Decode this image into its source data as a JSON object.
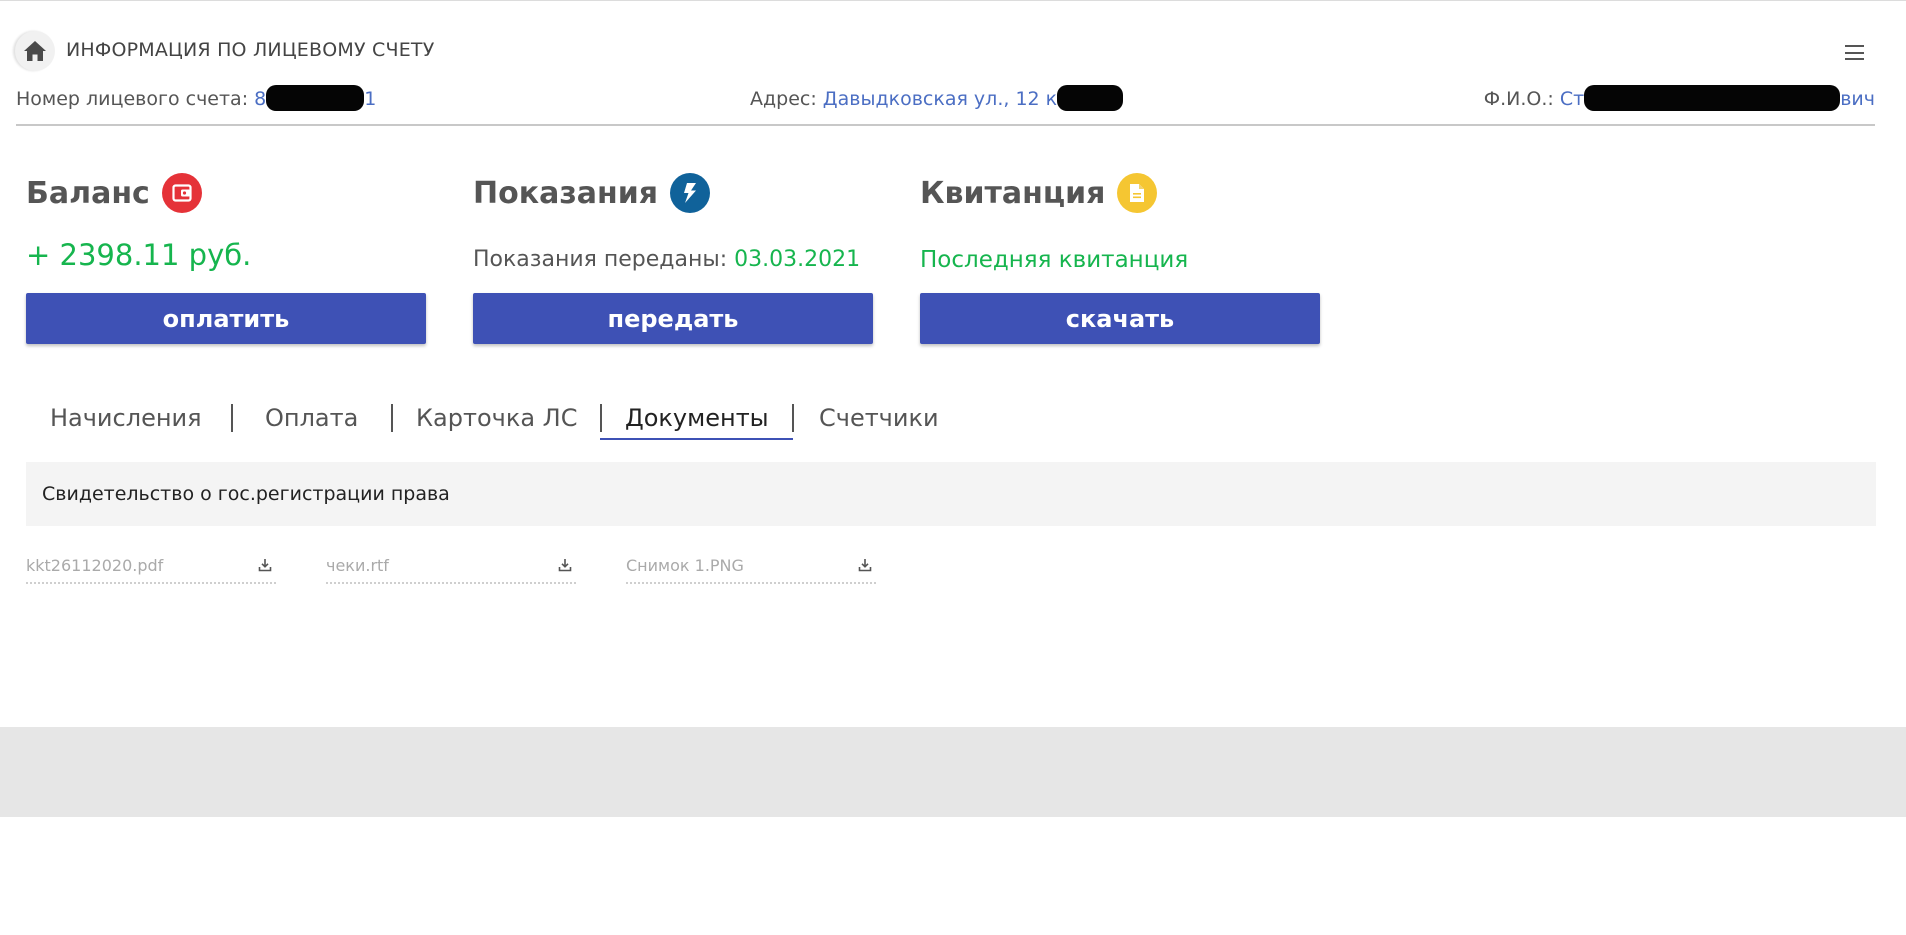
{
  "header": {
    "title": "ИНФОРМАЦИЯ ПО ЛИЦЕВОМУ СЧЕТУ",
    "account_label": "Номер лицевого счета:",
    "account_prefix": "8",
    "account_suffix": "1",
    "address_label": "Адрес:",
    "address_value": "Давыдковская ул., 12 к",
    "fio_label": "Ф.И.О.:",
    "fio_prefix": "Ст",
    "fio_suffix": "вич"
  },
  "cards": {
    "balance": {
      "title": "Баланс",
      "value": "+ 2398.11 руб.",
      "button": "оплатить"
    },
    "readings": {
      "title": "Показания",
      "status_label": "Показания переданы:",
      "status_date": "03.03.2021",
      "button": "передать"
    },
    "receipt": {
      "title": "Квитанция",
      "link": "Последняя квитанция",
      "button": "скачать"
    }
  },
  "tabs": [
    {
      "label": "Начисления"
    },
    {
      "label": "Оплата"
    },
    {
      "label": "Карточка ЛС"
    },
    {
      "label": "Документы",
      "active": true
    },
    {
      "label": "Счетчики"
    }
  ],
  "documents": {
    "section_title": "Свидетельство о гос.регистрации права",
    "files": [
      {
        "name": "kkt26112020.pdf"
      },
      {
        "name": "чеки.rtf"
      },
      {
        "name": "Снимок 1.PNG"
      }
    ]
  },
  "colors": {
    "accent": "#3e51b5",
    "positive": "#16b54e",
    "link": "#4b6ec3",
    "balance_badge": "#e53238",
    "readings_badge": "#10629a",
    "receipt_badge": "#f5c632"
  },
  "icons": {
    "home": "home-icon",
    "menu": "menu-icon",
    "balance": "wallet-icon",
    "readings": "lightning-icon",
    "receipt": "document-icon",
    "download": "download-icon"
  }
}
